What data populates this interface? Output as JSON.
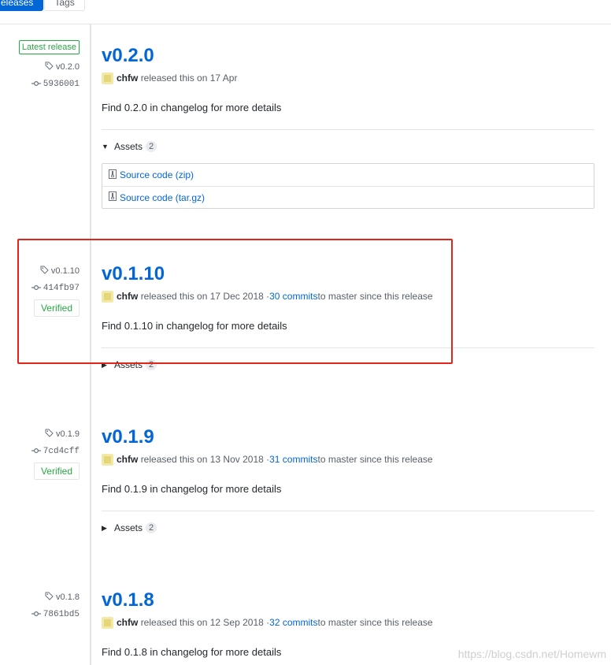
{
  "tabs": {
    "releases": "eleases",
    "tags": "Tags"
  },
  "releases": [
    {
      "latest_label": "Latest release",
      "tag": "v0.2.0",
      "commit": "5936001",
      "verified": "",
      "title": "v0.2.0",
      "author": "chfw",
      "released_text": "released this on 17 Apr",
      "commits_link": "",
      "commits_suffix": "",
      "description": "Find 0.2.0 in changelog for more details",
      "assets_label": "Assets",
      "assets_count": "2",
      "asset_items": [
        "Source code (zip)",
        "Source code (tar.gz)"
      ]
    },
    {
      "tag": "v0.1.10",
      "commit": "414fb97",
      "verified": "Verified",
      "title": "v0.1.10",
      "author": "chfw",
      "released_text": "released this on 17 Dec 2018 · ",
      "commits_link": "30 commits",
      "commits_suffix": " to master since this release",
      "description": "Find 0.1.10 in changelog for more details",
      "assets_label": "Assets",
      "assets_count": "2"
    },
    {
      "tag": "v0.1.9",
      "commit": "7cd4cff",
      "verified": "Verified",
      "title": "v0.1.9",
      "author": "chfw",
      "released_text": "released this on 13 Nov 2018 · ",
      "commits_link": "31 commits",
      "commits_suffix": " to master since this release",
      "description": "Find 0.1.9 in changelog for more details",
      "assets_label": "Assets",
      "assets_count": "2"
    },
    {
      "tag": "v0.1.8",
      "commit": "7861bd5",
      "verified": "",
      "title": "v0.1.8",
      "author": "chfw",
      "released_text": "released this on 12 Sep 2018 · ",
      "commits_link": "32 commits",
      "commits_suffix": " to master since this release",
      "description": "Find 0.1.8 in changelog for more details"
    }
  ],
  "watermark": "https://blog.csdn.net/Homewm",
  "colors": {
    "link": "#0366d6",
    "verified": "#28a745",
    "highlight": "#e1251b"
  }
}
